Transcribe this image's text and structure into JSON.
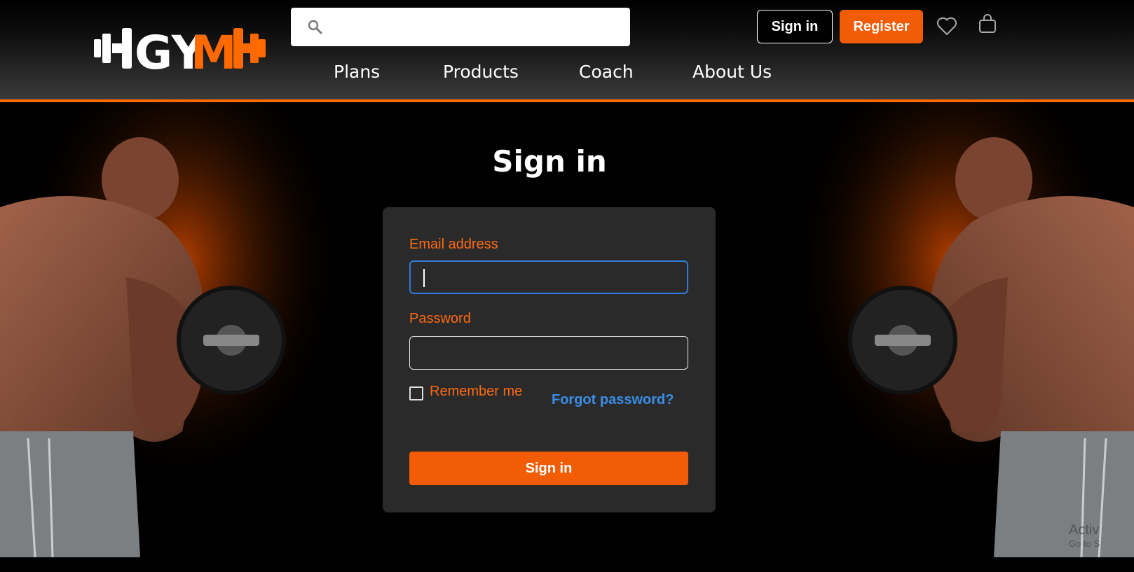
{
  "brand": {
    "logo_text_white": "GY",
    "logo_text_accent": "M",
    "accent_color": "#f25c05"
  },
  "search": {
    "value": "",
    "placeholder": "",
    "icon": "search-icon"
  },
  "header_actions": {
    "signin_label": "Sign in",
    "register_label": "Register",
    "wishlist_icon": "heart-icon",
    "cart_icon": "shopping-bag-icon"
  },
  "nav": {
    "items": [
      {
        "label": "Plans"
      },
      {
        "label": "Products"
      },
      {
        "label": "Coach"
      },
      {
        "label": "About Us"
      }
    ]
  },
  "page": {
    "title": "Sign in"
  },
  "form": {
    "email_label": "Email address",
    "email_value": "",
    "password_label": "Password",
    "password_value": "",
    "remember_label": "Remember me",
    "remember_checked": false,
    "forgot_label": "Forgot password?",
    "submit_label": "Sign in"
  },
  "watermark": {
    "line1": "Activ",
    "line2": "Go to S"
  },
  "colors": {
    "label_orange": "#ff6a13",
    "link_blue": "#3b8ee8",
    "card_bg": "#2a2a2a",
    "focus_blue": "#2f7bd6"
  }
}
